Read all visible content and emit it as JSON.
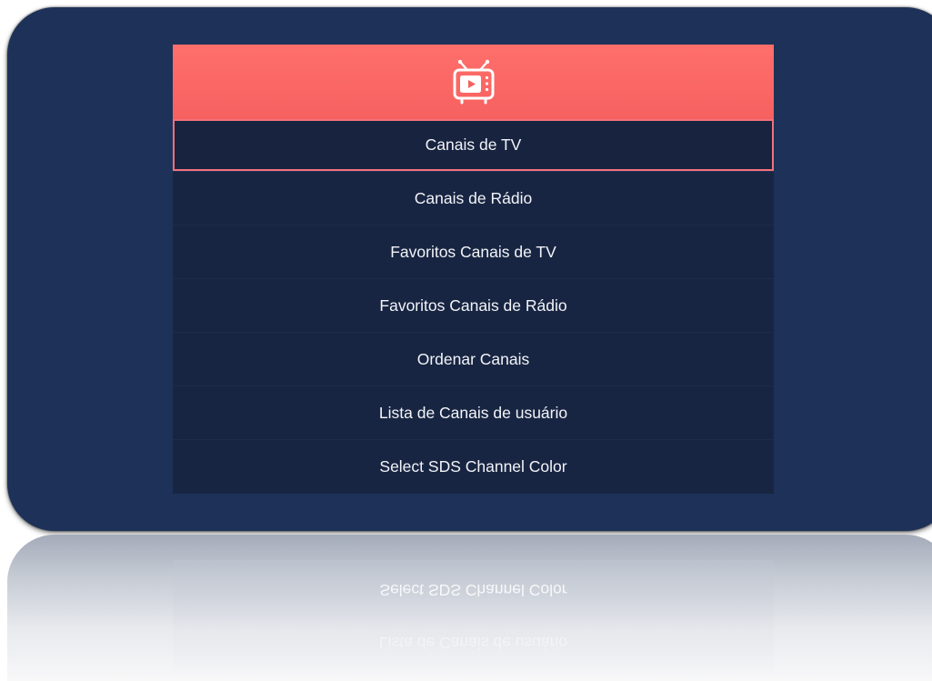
{
  "menu": {
    "header_icon": "tv-play-icon",
    "items": [
      {
        "label": "Canais de TV",
        "selected": true
      },
      {
        "label": "Canais de Rádio",
        "selected": false
      },
      {
        "label": "Favoritos Canais de TV",
        "selected": false
      },
      {
        "label": "Favoritos Canais de Rádio",
        "selected": false
      },
      {
        "label": "Ordenar Canais",
        "selected": false
      },
      {
        "label": "Lista de Canais de usuário",
        "selected": false
      },
      {
        "label": "Select SDS Channel Color",
        "selected": false
      }
    ]
  },
  "colors": {
    "background": "#1e3158",
    "header": "#ff6f6b",
    "item_background": "#182542",
    "selection_border": "#f2727c"
  }
}
